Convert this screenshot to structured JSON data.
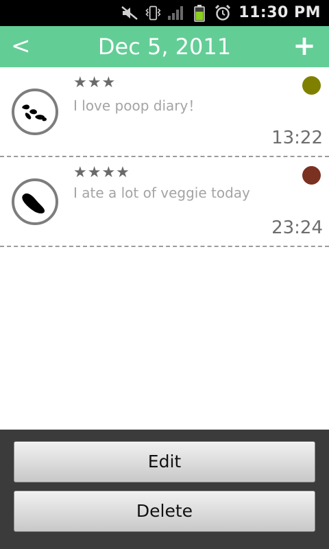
{
  "status_bar": {
    "time": "11:30 PM",
    "icons": [
      "mute-icon",
      "vibrate-icon",
      "signal-icon",
      "battery-icon",
      "alarm-icon"
    ]
  },
  "header": {
    "back_label": "<",
    "title": "Dec 5, 2011",
    "add_label": "+",
    "color": "#63cd96"
  },
  "entries": [
    {
      "stars": "★★★",
      "rating": 3,
      "note": "I love poop diary！",
      "time": "13:22",
      "color": "#808000",
      "shape_icon": "pellets-icon"
    },
    {
      "stars": "★★★★",
      "rating": 4,
      "note": "I ate a lot of veggie today",
      "time": "23:24",
      "color": "#7b3120",
      "shape_icon": "log-icon"
    }
  ],
  "actions": {
    "edit_label": "Edit",
    "delete_label": "Delete"
  }
}
